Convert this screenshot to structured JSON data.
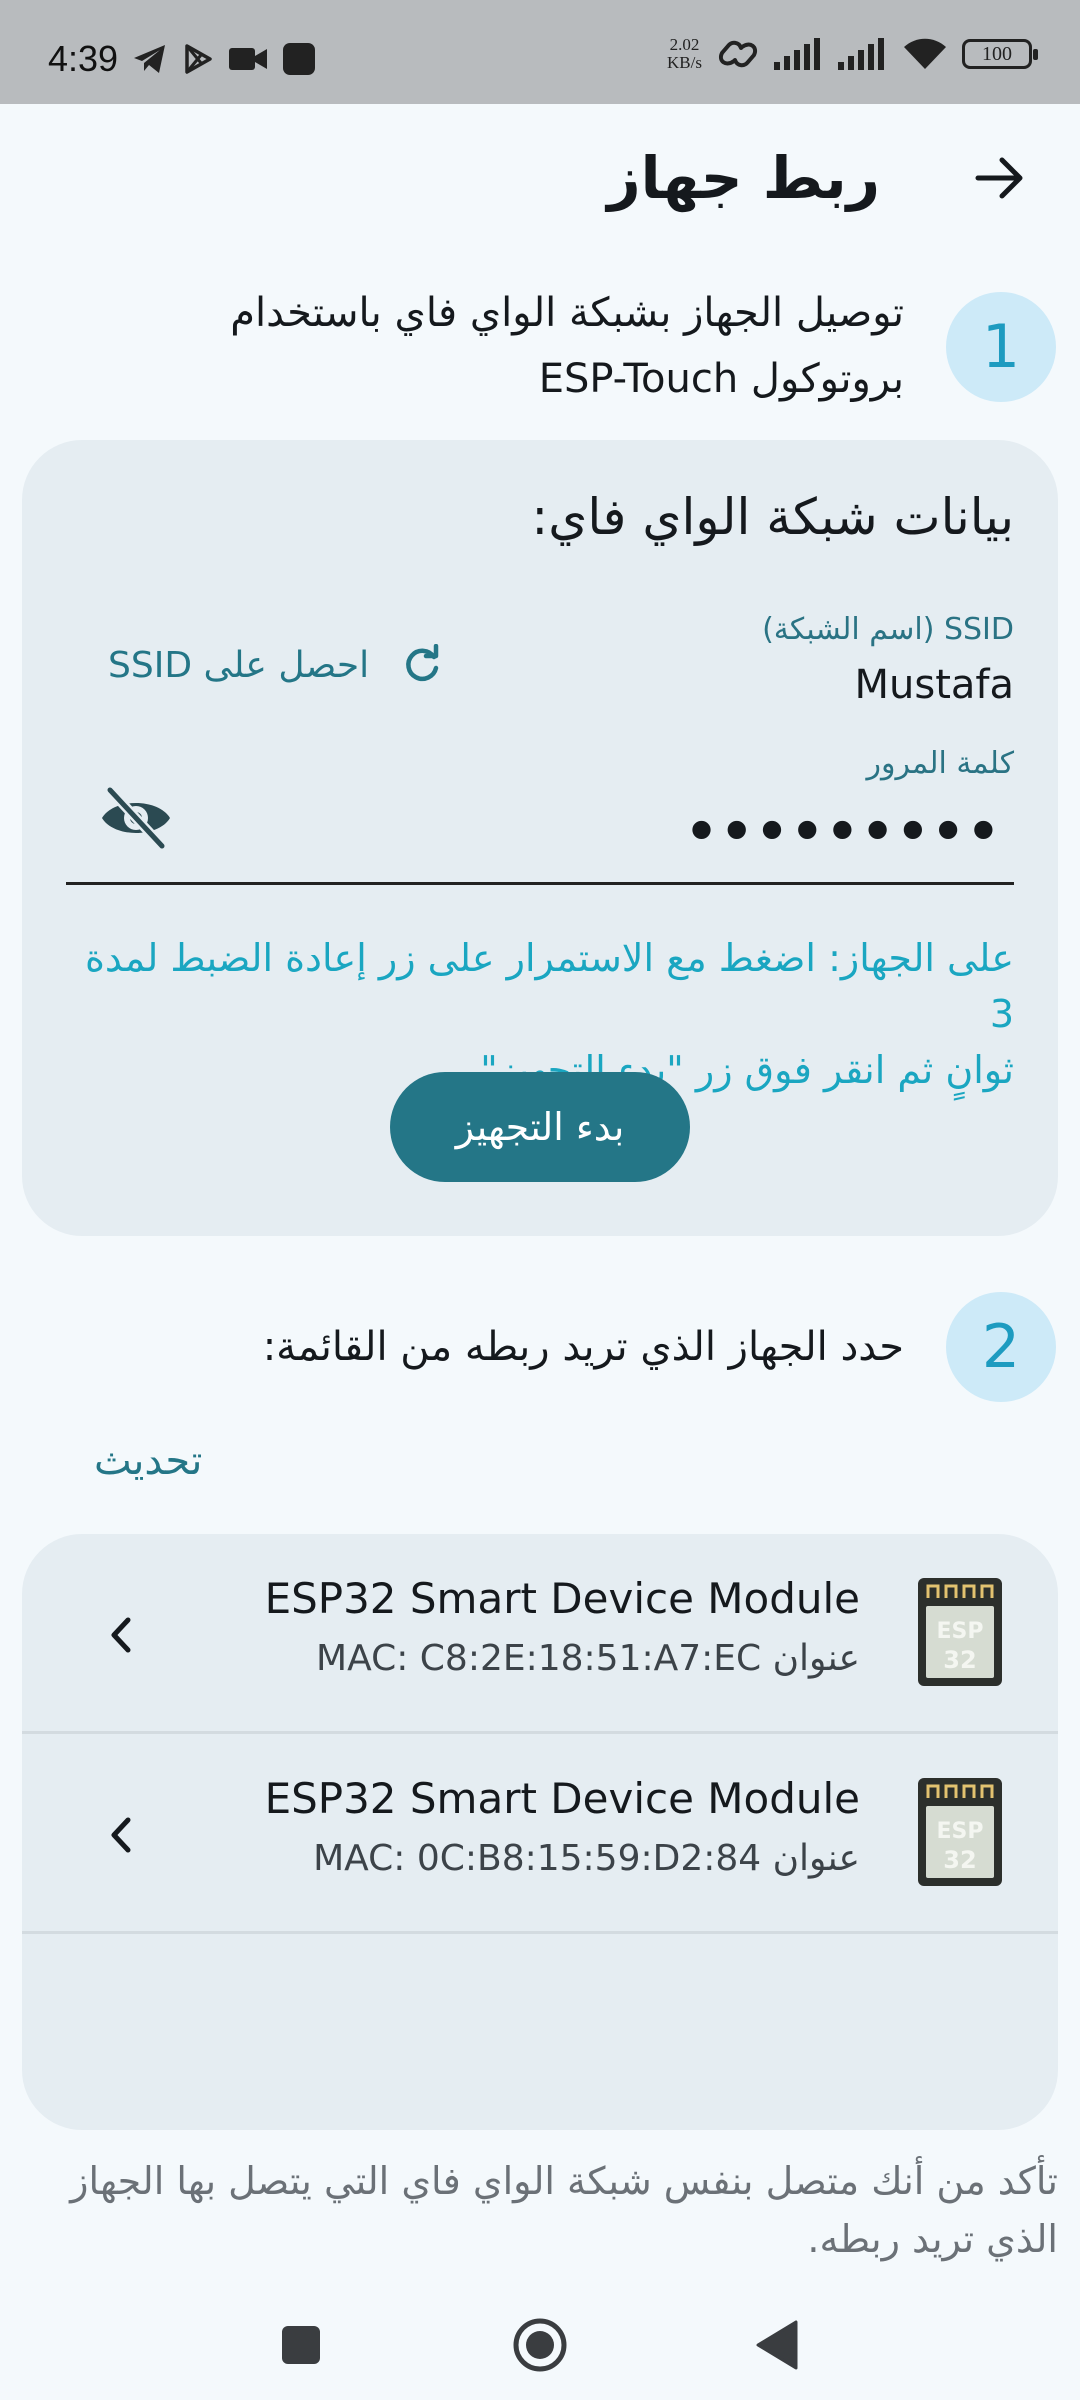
{
  "status_bar": {
    "time": "4:39",
    "net_speed_value": "2.02",
    "net_speed_unit": "KB/s",
    "battery": "100",
    "icons_left": [
      "telegram-icon",
      "play-store-icon",
      "video-camera-icon",
      "app-square-icon"
    ],
    "icons_right": [
      "link-icon",
      "signal-icon",
      "signal-icon",
      "wifi-icon",
      "battery-icon"
    ]
  },
  "header": {
    "title": "ربط جهاز",
    "back_icon": "arrow-right-icon"
  },
  "step1": {
    "number": "1",
    "text_line1": "توصيل الجهاز بشبكة الواي فاي باستخدام",
    "text_line2": "بروتوكول ESP-Touch"
  },
  "wifi_card": {
    "title": "بيانات شبكة الواي فاي:",
    "ssid_label": "SSID (اسم الشبكة)",
    "ssid_value": "Mustafa",
    "get_ssid_label": "احصل على SSID",
    "password_label": "كلمة المرور",
    "password_value": "•••••••••",
    "hint_line1": "على الجهاز: اضغط مع الاستمرار على زر إعادة الضبط لمدة 3",
    "hint_line2": "ثوانٍ ثم انقر فوق زر \"بدء التجهيز\".",
    "start_button": "بدء التجهيز"
  },
  "step2": {
    "number": "2",
    "text": "حدد الجهاز الذي تريد ربطه من القائمة:"
  },
  "refresh_label": "تحديث",
  "devices": [
    {
      "name": "ESP32 Smart Device Module",
      "mac": "عنوان MAC: C8:2E:18:51:A7:EC",
      "chip_label": "ESP 32"
    },
    {
      "name": "ESP32 Smart Device Module",
      "mac": "عنوان MAC: 0C:B8:15:59:D2:84",
      "chip_label": "ESP 32"
    }
  ],
  "note": {
    "line1": "تأكد من أنك متصل بنفس شبكة الواي فاي التي يتصل بها الجهاز",
    "line2": "الذي تريد ربطه."
  },
  "colors": {
    "accent": "#247687",
    "hint": "#1aa6c1",
    "card_bg": "#e5edf2",
    "step_circle_bg": "#cdeaf8",
    "page_bg": "#f4f9fc"
  }
}
